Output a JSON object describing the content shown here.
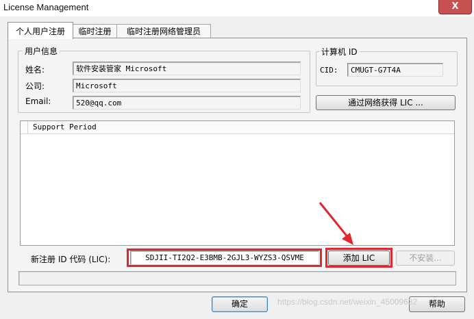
{
  "window": {
    "title": "License Management",
    "close_glyph": "X"
  },
  "tabs": [
    {
      "label": "个人用户注册",
      "active": true
    },
    {
      "label": "临时注册",
      "active": false
    },
    {
      "label": "临时注册网络管理员",
      "active": false
    }
  ],
  "user_info": {
    "legend": "用户信息",
    "name_label": "姓名:",
    "name_value": "软件安装管家 Microsoft",
    "company_label": "公司:",
    "company_value": "Microsoft",
    "email_label": "Email:",
    "email_value": "520@qq.com"
  },
  "computer_id": {
    "legend": "计算机 ID",
    "cid_label": "CID:",
    "cid_value": "CMUGT-G7T4A"
  },
  "network_button": {
    "label": "通过网络获得 LIC ..."
  },
  "list": {
    "header": "Support Period",
    "rows": []
  },
  "registration": {
    "label": "新注册 ID 代码 (LIC):",
    "code_value": "SDJII-TI2Q2-E3BMB-2GJL3-WYZS3-QSVME",
    "add_button": "添加 LIC",
    "uninstall_button": "不安装..."
  },
  "footer": {
    "ok_button": "确定",
    "help_button": "帮助"
  },
  "watermark": "https://blog.csdn.net/weixin_45009632",
  "colors": {
    "highlight_red": "#e0262f",
    "close_button": "#c75050"
  }
}
